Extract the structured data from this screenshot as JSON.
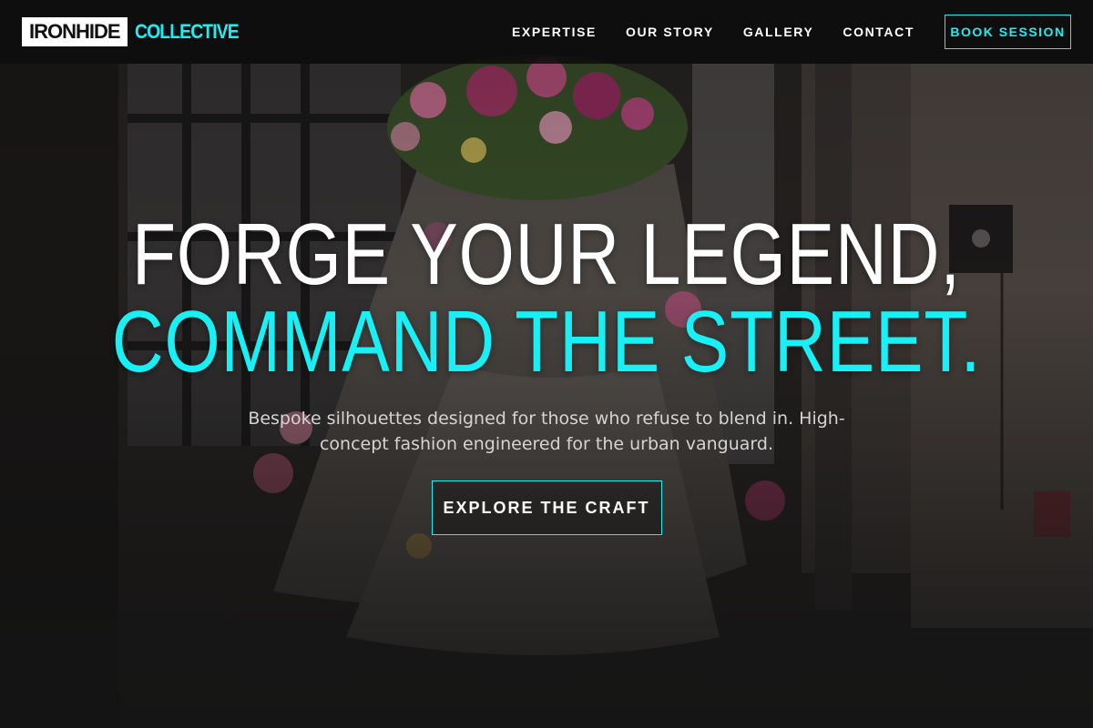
{
  "nav": {
    "logo_primary": "IRONHIDE",
    "logo_secondary": "COLLECTIVE",
    "links": [
      "EXPERTISE",
      "OUR STORY",
      "GALLERY",
      "CONTACT"
    ],
    "cta": "BOOK SESSION"
  },
  "hero": {
    "headline_line1": "FORGE YOUR LEGEND,",
    "headline_line2": "COMMAND THE STREET.",
    "subtitle": "Bespoke silhouettes designed for those who refuse to blend in. High-concept fashion engineered for the urban vanguard.",
    "cta": "EXPLORE THE CRAFT"
  },
  "colors": {
    "accent": "#19f0f5",
    "nav_bg": "#0c0c0c",
    "text_primary": "#ffffff",
    "text_muted": "#d4d4d4"
  }
}
